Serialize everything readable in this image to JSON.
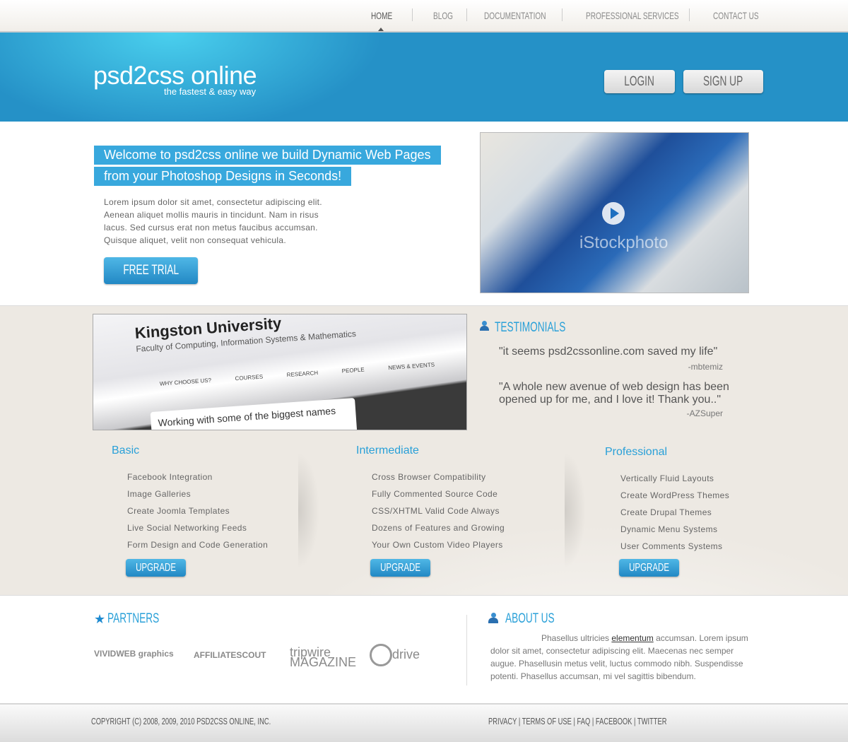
{
  "nav": {
    "items": [
      {
        "label": "HOME",
        "active": true
      },
      {
        "label": "BLOG"
      },
      {
        "label": "DOCUMENTATION"
      },
      {
        "label": "PROFESSIONAL SERVICES"
      },
      {
        "label": "CONTACT US"
      }
    ]
  },
  "header": {
    "logo": "psd2css online",
    "tagline": "the fastest & easy way",
    "login": "LOGIN",
    "signup": "SIGN UP",
    "color": "#2591c7"
  },
  "hero": {
    "title_line1": "Welcome to psd2css online we build Dynamic Web Pages",
    "title_line2": "from your Photoshop Designs in Seconds!",
    "body": "Lorem ipsum dolor sit amet, consectetur adipiscing elit. Aenean aliquet mollis mauris in tincidunt. Nam in risus lacus. Sed cursus erat non metus faucibus accumsan. Quisque aliquet, velit non consequat vehicula.",
    "cta": "FREE TRIAL",
    "watermark": "iStockphoto"
  },
  "showcase": {
    "heading": "Kingston University",
    "subheading": "Faculty of Computing, Information Systems & Mathematics",
    "menu": [
      "WHY CHOOSE US?",
      "COURSES",
      "RESEARCH",
      "PEOPLE",
      "NEWS & EVENTS"
    ],
    "caption": "Working with some of the biggest names"
  },
  "testimonials": {
    "title": "TESTIMONIALS",
    "items": [
      {
        "quote": "\"it seems psd2cssonline.com saved my life\"",
        "author": "-mbtemiz"
      },
      {
        "quote": "\"A whole new avenue of web design has been opened up for me, and I love it! Thank you..\"",
        "author": "-AZSuper"
      }
    ]
  },
  "plans": [
    {
      "name": "Basic",
      "features": [
        "Facebook Integration",
        "Image Galleries",
        "Create Joomla Templates",
        "Live Social Networking Feeds",
        "Form Design and Code Generation"
      ],
      "button": "UPGRADE"
    },
    {
      "name": "Intermediate",
      "features": [
        "Cross Browser Compatibility",
        "Fully Commented Source Code",
        "CSS/XHTML Valid Code Always",
        "Dozens of Features and Growing",
        "Your Own Custom Video Players"
      ],
      "button": "UPGRADE"
    },
    {
      "name": "Professional",
      "features": [
        "Vertically Fluid Layouts",
        "Create WordPress Themes",
        "Create Drupal Themes",
        "Dynamic Menu Systems",
        "User Comments Systems"
      ],
      "button": "UPGRADE"
    }
  ],
  "partners": {
    "title": "PARTNERS",
    "logos": [
      "VIVIDWEB graphics",
      "AFFILIATESCOUT",
      "tripwire MAGAZINE",
      "drive"
    ]
  },
  "about": {
    "title": "ABOUT US",
    "text_before": "Phasellus ultricies ",
    "link": "elementum",
    "text_after": " accumsan. Lorem ipsum dolor sit amet, consectetur adipiscing elit. Maecenas nec semper augue. Phasellusin metus velit, luctus commodo nibh. Suspendisse potenti. Phasellus accumsan, mi vel sagittis bibendum."
  },
  "footer": {
    "copyright": "COPYRIGHT (C) 2008, 2009, 2010 PSD2CSS ONLINE, INC.",
    "links": [
      "PRIVACY",
      "TERMS OF USE",
      "FAQ",
      "FACEBOOK",
      "TWITTER"
    ]
  }
}
